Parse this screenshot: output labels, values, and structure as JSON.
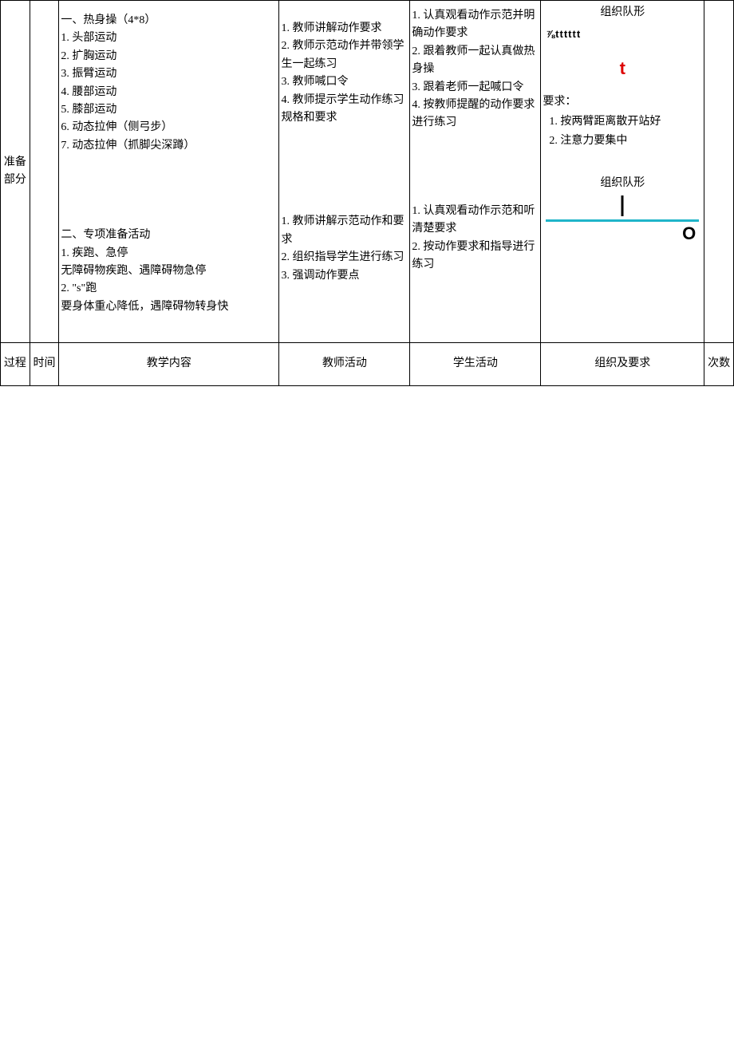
{
  "row1": {
    "section_label": "准备部分",
    "col_content": {
      "block1_title": "一、热身操（4*8）",
      "block1_items": [
        "1. 头部运动",
        "2. 扩胸运动",
        "3. 振臂运动",
        "4. 腰部运动",
        "5. 膝部运动",
        "6. 动态拉伸（侧弓步）",
        "7. 动态拉伸（抓脚尖深蹲）"
      ],
      "block2_title": "二、专项准备活动",
      "block2_items": [
        "1. 疾跑、急停",
        "无障碍物疾跑、遇障碍物急停",
        "2. \"s\"跑",
        "要身体重心降低，遇障碍物转身快"
      ]
    },
    "col_teacher": {
      "block1": [
        "1. 教师讲解动作要求",
        "2. 教师示范动作并带领学生一起练习",
        "3. 教师喊口令",
        "4. 教师提示学生动作练习规格和要求"
      ],
      "block2": [
        "1. 教师讲解示范动作和要求",
        "2. 组织指导学生进行练习",
        "3. 强调动作要点"
      ]
    },
    "col_student": {
      "block1": [
        "1. 认真观看动作示范并明确动作要求",
        "2. 跟着教师一起认真做热身操",
        "3. 跟着老师一起喊口令",
        "4. 按教师提醒的动作要求进行练习"
      ],
      "block2": [
        "1. 认真观看动作示范和听清楚要求",
        "2. 按动作要求和指导进行练习"
      ]
    },
    "col_org": {
      "formation_label": "组织队形",
      "sym_line": "⅞tttttt",
      "sym_big": "t",
      "req_label": "要求：",
      "req_items": [
        "按两臂距离散开站好",
        "注意力要集中"
      ],
      "formation_label2": "组织队形",
      "big_o": "O"
    }
  },
  "header_row": {
    "c1": "过程",
    "c2": "时间",
    "c3": "教学内容",
    "c4": "教师活动",
    "c5": "学生活动",
    "c6": "组织及要求",
    "c7": "次数"
  }
}
